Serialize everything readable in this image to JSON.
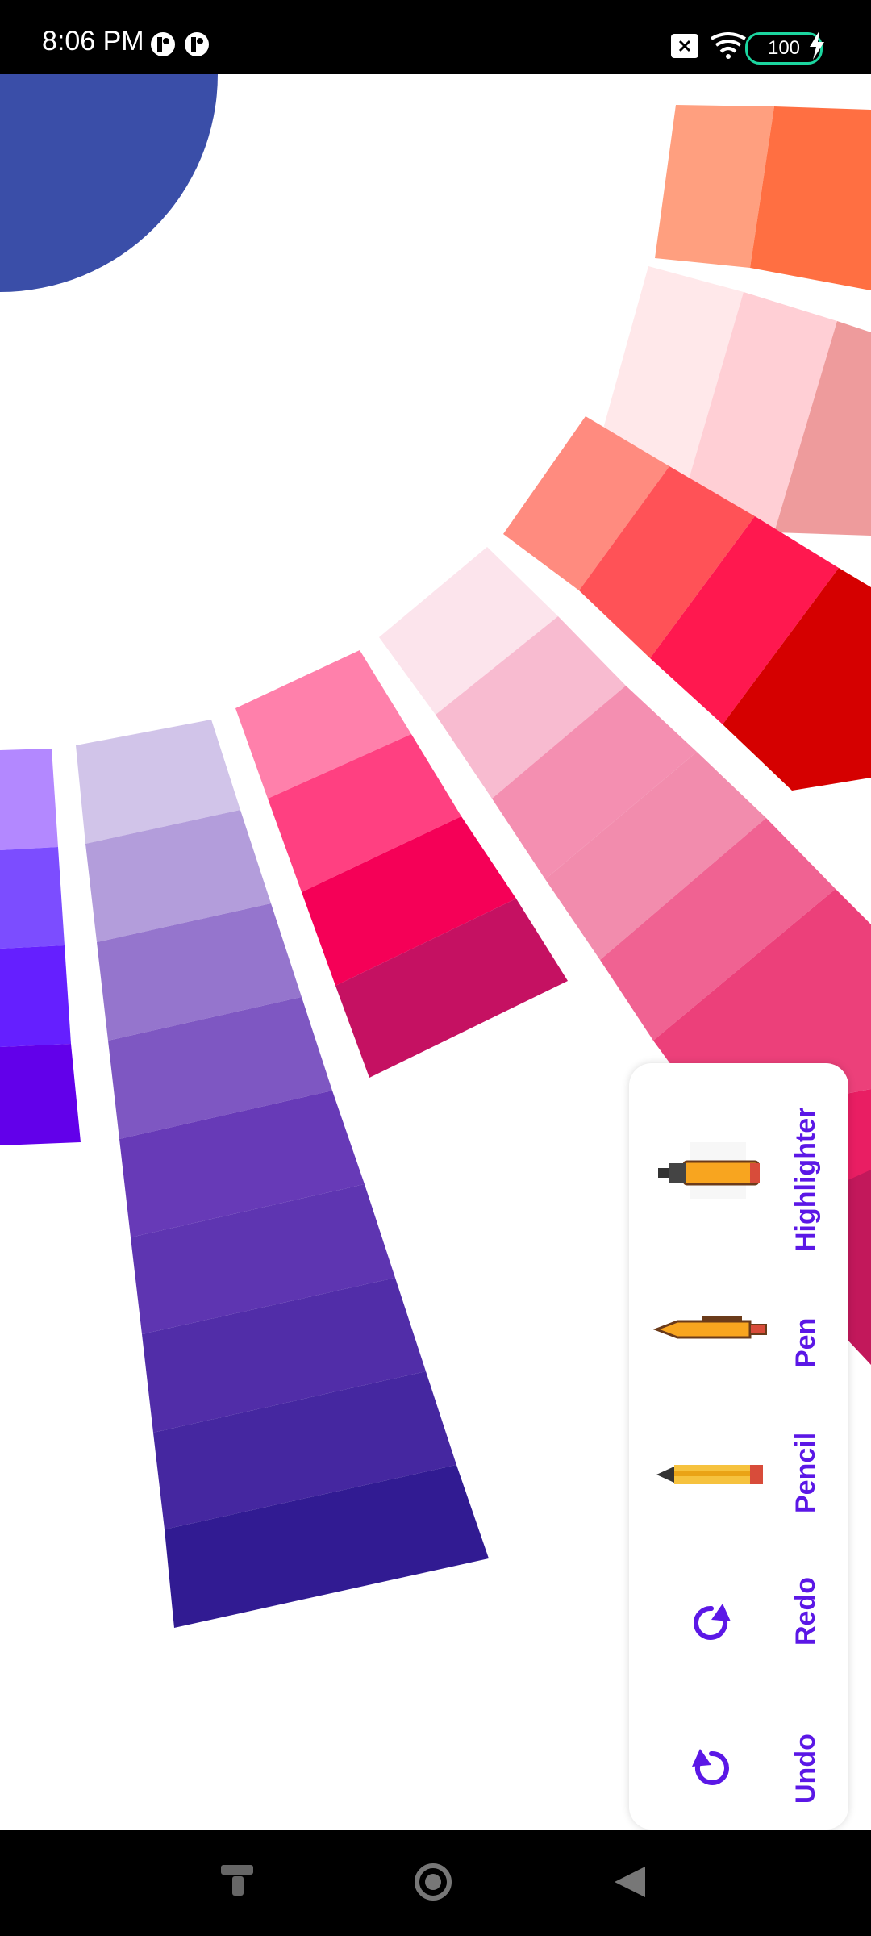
{
  "status": {
    "time": "8:06 PM",
    "battery": "100"
  },
  "toolbar": {
    "items": [
      {
        "label": "Highlighter",
        "icon": "highlighter-icon"
      },
      {
        "label": "Pen",
        "icon": "pen-icon"
      },
      {
        "label": "Pencil",
        "icon": "pencil-icon"
      },
      {
        "label": "Redo",
        "icon": "redo-icon"
      },
      {
        "label": "Undo",
        "icon": "undo-icon"
      }
    ]
  },
  "colors": {
    "accent": "#5b17e6",
    "blue_circle": "#3a4ea8"
  }
}
